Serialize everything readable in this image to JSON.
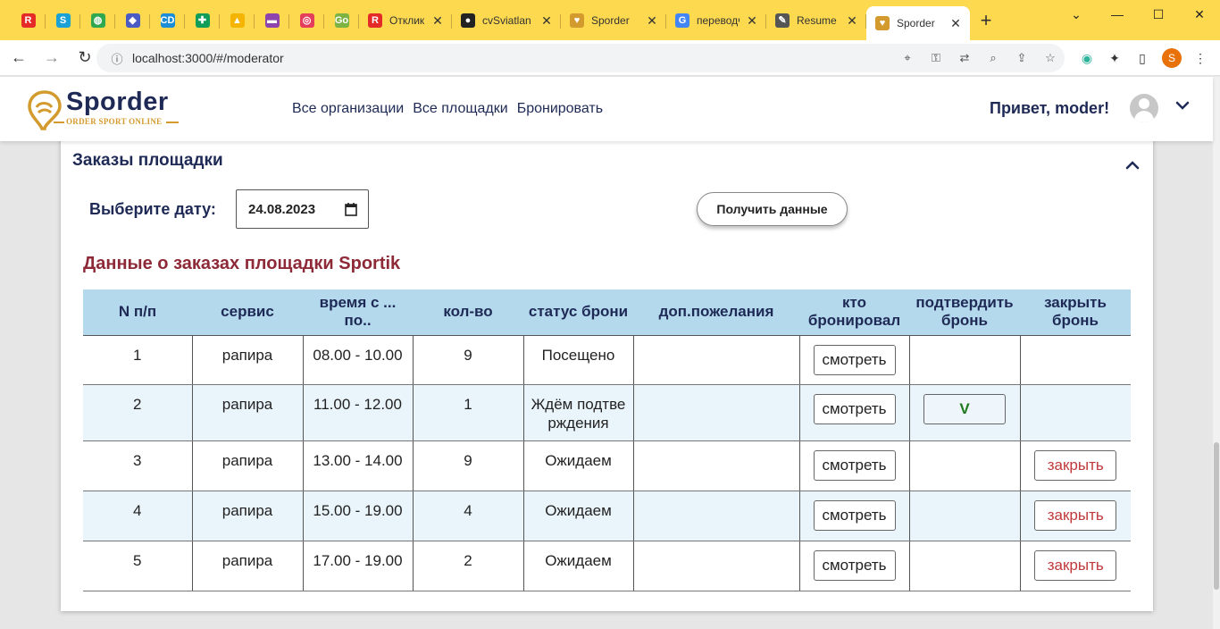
{
  "browser": {
    "pinned_tabs": [
      {
        "icon": "rabota-icon",
        "glyph": "R",
        "color": "#e52b27"
      },
      {
        "icon": "s-icon",
        "glyph": "S",
        "color": "#1aa1d6"
      },
      {
        "icon": "globe-icon",
        "glyph": "◍",
        "color": "#2fa84f"
      },
      {
        "icon": "shield-icon",
        "glyph": "◆",
        "color": "#4a5bc4"
      },
      {
        "icon": "cd-icon",
        "glyph": "CD",
        "color": "#1b8dd6"
      },
      {
        "icon": "sheets-icon",
        "glyph": "✚",
        "color": "#0f9d58"
      },
      {
        "icon": "drive-icon",
        "glyph": "▲",
        "color": "#f4b400"
      },
      {
        "icon": "purple-icon",
        "glyph": "▬",
        "color": "#8e44ad"
      },
      {
        "icon": "target-icon",
        "glyph": "◎",
        "color": "#e53e5c"
      },
      {
        "icon": "go-icon",
        "glyph": "Go",
        "color": "#7cb342"
      }
    ],
    "tabs": [
      {
        "title": "Отклик",
        "icon": "rabota-icon",
        "glyph": "R",
        "color": "#e52b27",
        "active": false
      },
      {
        "title": "cvSviatlan",
        "icon": "github-icon",
        "glyph": "●",
        "color": "#222222",
        "active": false
      },
      {
        "title": "Sporder",
        "icon": "sporder-icon",
        "glyph": "♥",
        "color": "#d39a2d",
        "active": false
      },
      {
        "title": "переводч",
        "icon": "google-icon",
        "glyph": "G",
        "color": "#4285f4",
        "active": false
      },
      {
        "title": "Resume",
        "icon": "resume-icon",
        "glyph": "✎",
        "color": "#555555",
        "active": false
      },
      {
        "title": "Sporder",
        "icon": "sporder-icon",
        "glyph": "♥",
        "color": "#d39a2d",
        "active": true
      }
    ],
    "url": "localhost:3000/#/moderator",
    "profile_letter": "S"
  },
  "header": {
    "brand": "Sporder",
    "tagline": "ORDER SPORT ONLINE",
    "nav": [
      "Все организации",
      "Все площадки",
      "Бронировать"
    ],
    "greeting": "Привет, moder!"
  },
  "section": {
    "title": "Заказы площадки",
    "date_label": "Выберите дату:",
    "date_value": "24.08.2023",
    "get_button": "Получить данные",
    "data_title": "Данные о заказах площадки Sportik"
  },
  "table": {
    "headers": [
      "N п/п",
      "сервис",
      "время с ... по..",
      "кол-во",
      "статус брони",
      "доп.пожелания",
      "кто бронировал",
      "подтвердить бронь",
      "закрыть бронь"
    ],
    "view_label": "смотреть",
    "confirm_label": "V",
    "close_label": "закрыть",
    "rows": [
      {
        "n": "1",
        "service": "рапира",
        "time": "08.00 - 10.00",
        "qty": "9",
        "status": "Посещено",
        "wishes": "",
        "confirm": false,
        "close": false
      },
      {
        "n": "2",
        "service": "рапира",
        "time": "11.00 - 12.00",
        "qty": "1",
        "status": "Ждём подтве рждения",
        "wishes": "",
        "confirm": true,
        "close": false
      },
      {
        "n": "3",
        "service": "рапира",
        "time": "13.00 - 14.00",
        "qty": "9",
        "status": "Ожидаем",
        "wishes": "",
        "confirm": false,
        "close": true
      },
      {
        "n": "4",
        "service": "рапира",
        "time": "15.00 - 19.00",
        "qty": "4",
        "status": "Ожидаем",
        "wishes": "",
        "confirm": false,
        "close": true
      },
      {
        "n": "5",
        "service": "рапира",
        "time": "17.00 - 19.00",
        "qty": "2",
        "status": "Ожидаем",
        "wishes": "",
        "confirm": false,
        "close": true
      }
    ]
  },
  "colors": {
    "tabstrip": "#fdd94f",
    "brand_navy": "#1e2a55",
    "accent_gold": "#d39a2d",
    "data_title": "#8e2a37",
    "table_header": "#b4d8ec",
    "confirm_green": "#1d7a1d",
    "close_red": "#c0393b"
  }
}
